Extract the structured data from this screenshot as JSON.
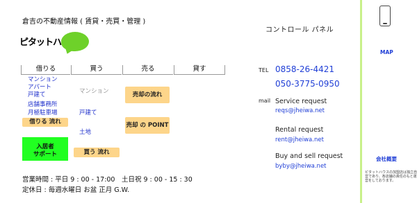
{
  "header": {
    "tagline": "倉吉の不動産情報 ( 賃貸・売買・管理 )",
    "logo_text": "ピタットハウス"
  },
  "tabs": [
    {
      "label": "借りる"
    },
    {
      "label": "買う"
    },
    {
      "label": "売る"
    },
    {
      "label": "貸す"
    }
  ],
  "rent": {
    "links": [
      "マンション",
      "アパート",
      "戸建て",
      "店舗事務所",
      "月極駐車場"
    ],
    "flow_button": "借りる 流れ",
    "tenant_support_line1": "入居者",
    "tenant_support_line2": "サポート"
  },
  "buy": {
    "mansion": "マンション",
    "house": "戸建て",
    "land": "土地",
    "flow_button": "買う 流れ"
  },
  "sell": {
    "flow_button": "売却の流れ",
    "point_button": "売却 の POINT"
  },
  "hours": {
    "business": "営業時間 : 平日 9 : 00 - 17:00　土日祝 9 : 00 - 15 : 30",
    "holiday": "定休日 : 毎週水曜日 お盆 正月 G.W."
  },
  "panel": {
    "title": "コントロール パネル",
    "tel_label": "TEL",
    "phone1": "0858-26-4421",
    "phone2": "050-3775-0950",
    "mail_label": "mail",
    "requests": [
      {
        "title": "Service request",
        "email": "reqs@jheiwa.net"
      },
      {
        "title": "Rental request",
        "email": "rent@jheiwa.net"
      },
      {
        "title": "Buy and sell request",
        "email": "byby@jheiwa.net"
      }
    ]
  },
  "sidebar": {
    "map": "MAP",
    "company": "会社概要",
    "note": "ピタットハウスの加盟店は独立自営であり、各店舗の責任のもと運営をしております。"
  }
}
